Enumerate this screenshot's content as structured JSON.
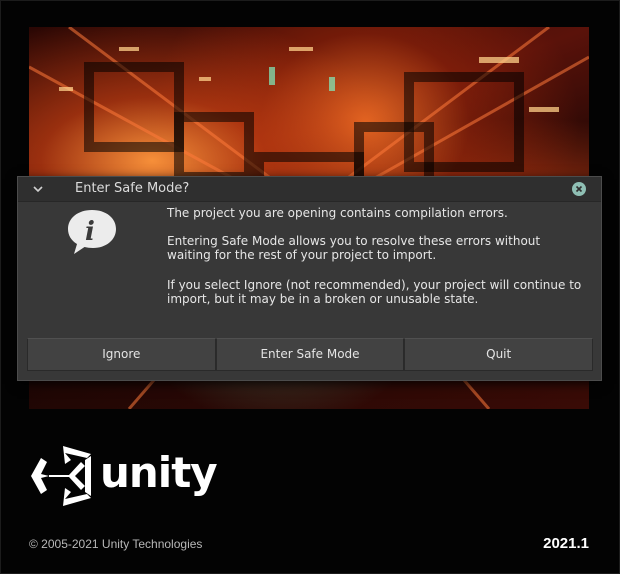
{
  "splash": {
    "copyright": "© 2005-2021 Unity Technologies",
    "version": "2021.1",
    "wordmark": "unity"
  },
  "dialog": {
    "title": "Enter Safe Mode?",
    "icon": "info-icon",
    "message_1": "The project you are opening contains compilation errors.",
    "message_2": "Entering Safe Mode allows you to resolve these errors without waiting for the rest of your project to import.",
    "message_3": "If you select Ignore (not recommended), your project will continue to import, but it may be in a broken or unusable state.",
    "buttons": {
      "ignore": "Ignore",
      "enter_safe_mode": "Enter Safe Mode",
      "quit": "Quit"
    }
  },
  "colors": {
    "dialog_bg": "#383838",
    "titlebar_bg": "#2f2f2f",
    "close_button": "#8fbfb4"
  }
}
